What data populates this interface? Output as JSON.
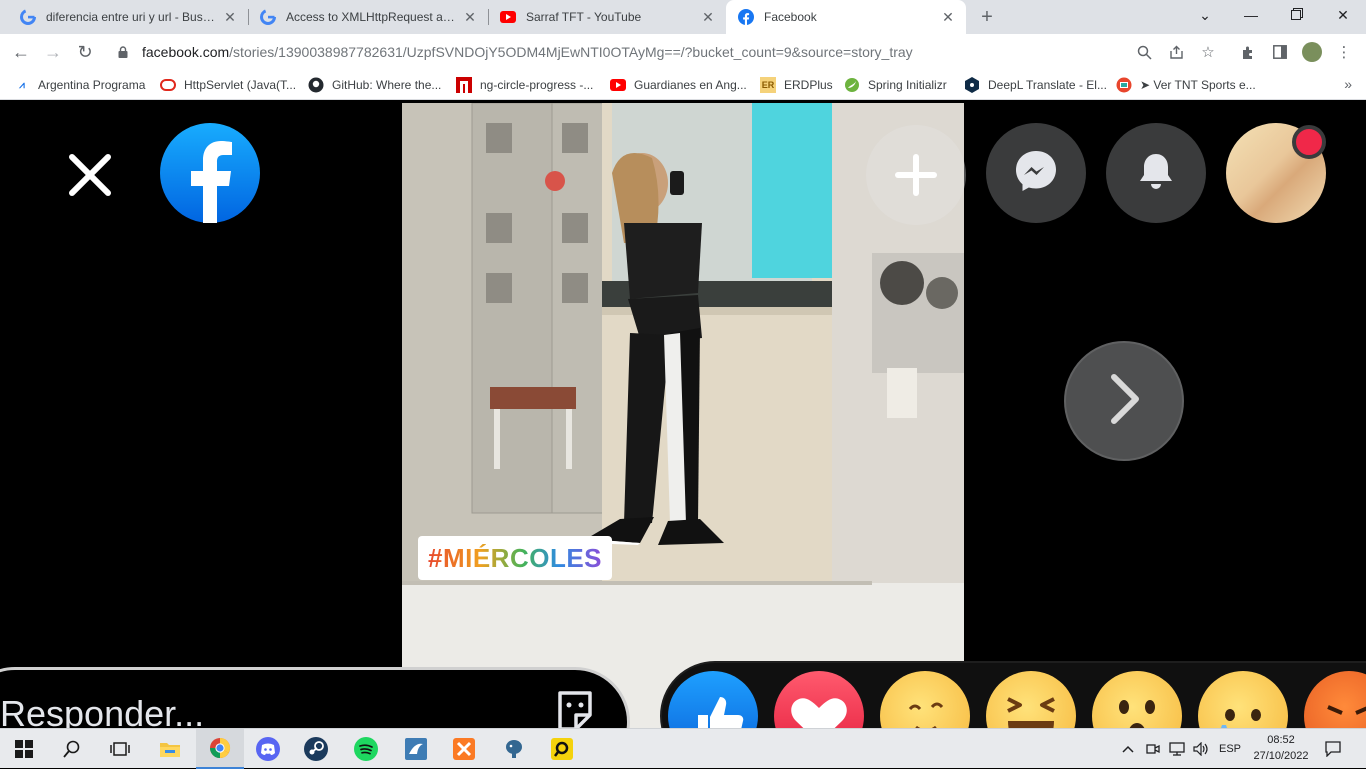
{
  "browser": {
    "tabs": [
      {
        "title": "diferencia entre uri y url - Buscar",
        "icon": "google-icon",
        "active": false
      },
      {
        "title": "Access to XMLHttpRequest at 'ht",
        "icon": "google-icon",
        "active": false
      },
      {
        "title": "Sarraf TFT - YouTube",
        "icon": "youtube-icon",
        "active": false
      },
      {
        "title": "Facebook",
        "icon": "facebook-icon",
        "active": true
      }
    ],
    "newtab_label": "+",
    "url_host": "facebook.com",
    "url_path": "/stories/1390038987782631/UzpfSVNDOjY5ODM4MjEwNTI0OTAyMg==/?bucket_count=9&source=story_tray",
    "bookmarks": [
      "Argentina Programa",
      "HttpServlet (Java(T...",
      "GitHub: Where the...",
      "ng-circle-progress -...",
      "Guardianes en Ang...",
      "ERDPlus",
      "Spring Initializr",
      "DeepL Translate - El...",
      "➤ Ver TNT Sports e..."
    ],
    "bookmarks_more": "»"
  },
  "story": {
    "hashtag": "#MIÉRCOLES",
    "reply_placeholder": "Responder...",
    "reactions": [
      "like",
      "love",
      "care",
      "haha",
      "wow",
      "sad",
      "angry"
    ]
  },
  "taskbar": {
    "language": "ESP",
    "time": "08:52",
    "date": "27/10/2022"
  },
  "colors": {
    "facebook_blue": "#0866ff",
    "notification_red": "#f02849",
    "tabstrip": "#dee1e6"
  }
}
